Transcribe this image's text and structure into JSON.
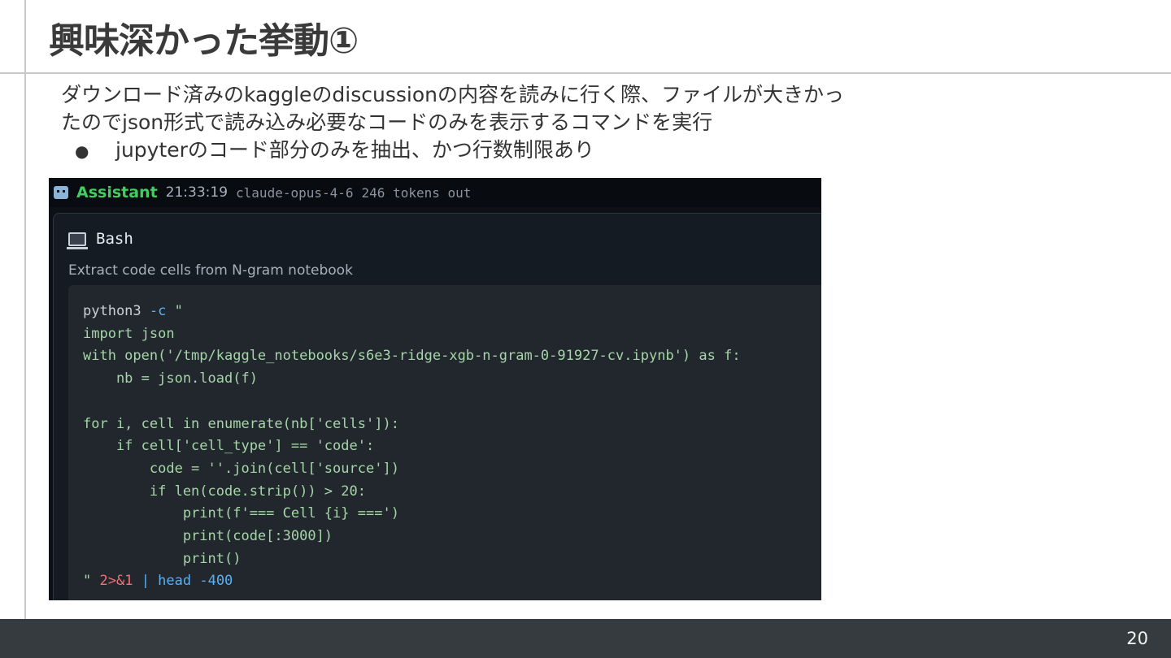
{
  "slide": {
    "title": "興味深かった挙動①",
    "body_line1": "ダウンロード済みのkaggleのdiscussionの内容を読みに行く際、ファイルが大きかっ",
    "body_line2": "たのでjson形式で読み込み必要なコードのみを表示するコマンドを実行",
    "bullet": "jupyterのコード部分のみを抽出、かつ行数制限あり",
    "bullet_glyph": "●",
    "page_number": "20"
  },
  "screenshot": {
    "header": {
      "assistant_label": "Assistant",
      "time": "21:33:19",
      "model": "claude-opus-4-6",
      "tokens": "246 tokens out"
    },
    "tool_name": "Bash",
    "description": "Extract code cells from N-gram notebook",
    "code_lines": [
      "python3 -c \"",
      "import json",
      "with open('/tmp/kaggle_notebooks/s6e3-ridge-xgb-n-gram-0-91927-cv.ipynb') as f:",
      "    nb = json.load(f)",
      "",
      "for i, cell in enumerate(nb['cells']):",
      "    if cell['cell_type'] == 'code':",
      "        code = ''.join(cell['source'])",
      "        if len(code.strip()) > 20:",
      "            print(f'=== Cell {i} ===')",
      "            print(code[:3000])",
      "            print()",
      "\" 2>&1 | head -400"
    ],
    "colors": {
      "assistant": "#3ecf5e",
      "code_string": "#a5d6a7",
      "code_flag": "#5ab0f0",
      "code_number": "#f07178"
    }
  }
}
